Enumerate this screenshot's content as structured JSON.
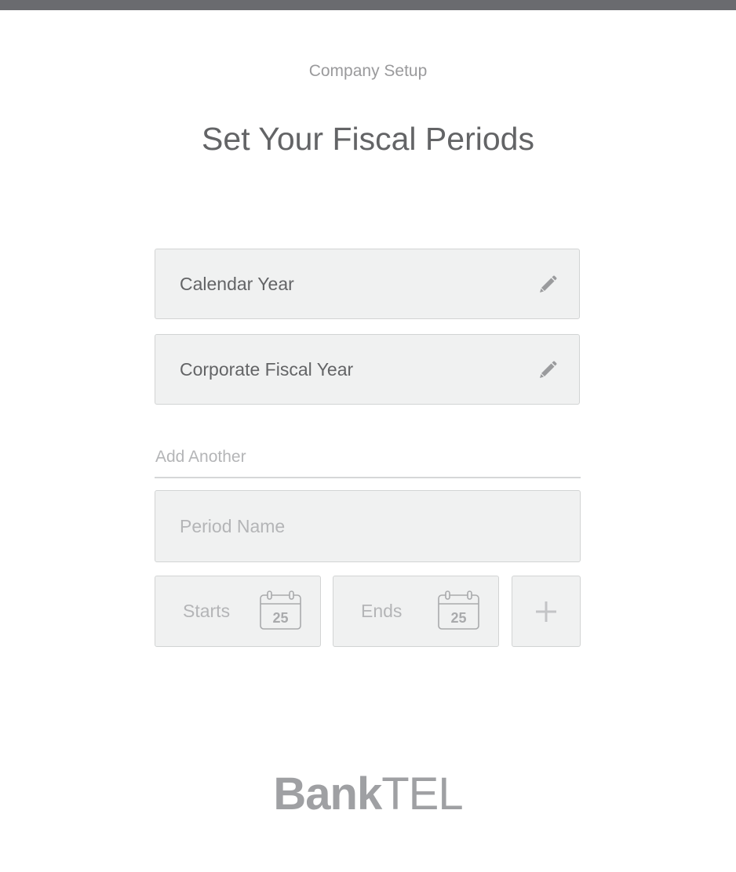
{
  "header": {
    "subtitle": "Company Setup",
    "title": "Set Your Fiscal Periods"
  },
  "periods": [
    {
      "label": "Calendar Year",
      "icon": "pencil-icon"
    },
    {
      "label": "Corporate Fiscal Year",
      "icon": "pencil-icon"
    }
  ],
  "add_section": {
    "label": "Add Another",
    "period_name_placeholder": "Period Name",
    "starts_placeholder": "Starts",
    "ends_placeholder": "Ends",
    "calendar_day": "25",
    "add_icon": "plus-icon"
  },
  "brand": {
    "bank": "Bank",
    "tel": "TEL"
  },
  "colors": {
    "top_bar": "#6a6b6f",
    "field_bg": "#f0f1f1",
    "text_dark": "#636466",
    "text_light": "#b4b5b7"
  }
}
